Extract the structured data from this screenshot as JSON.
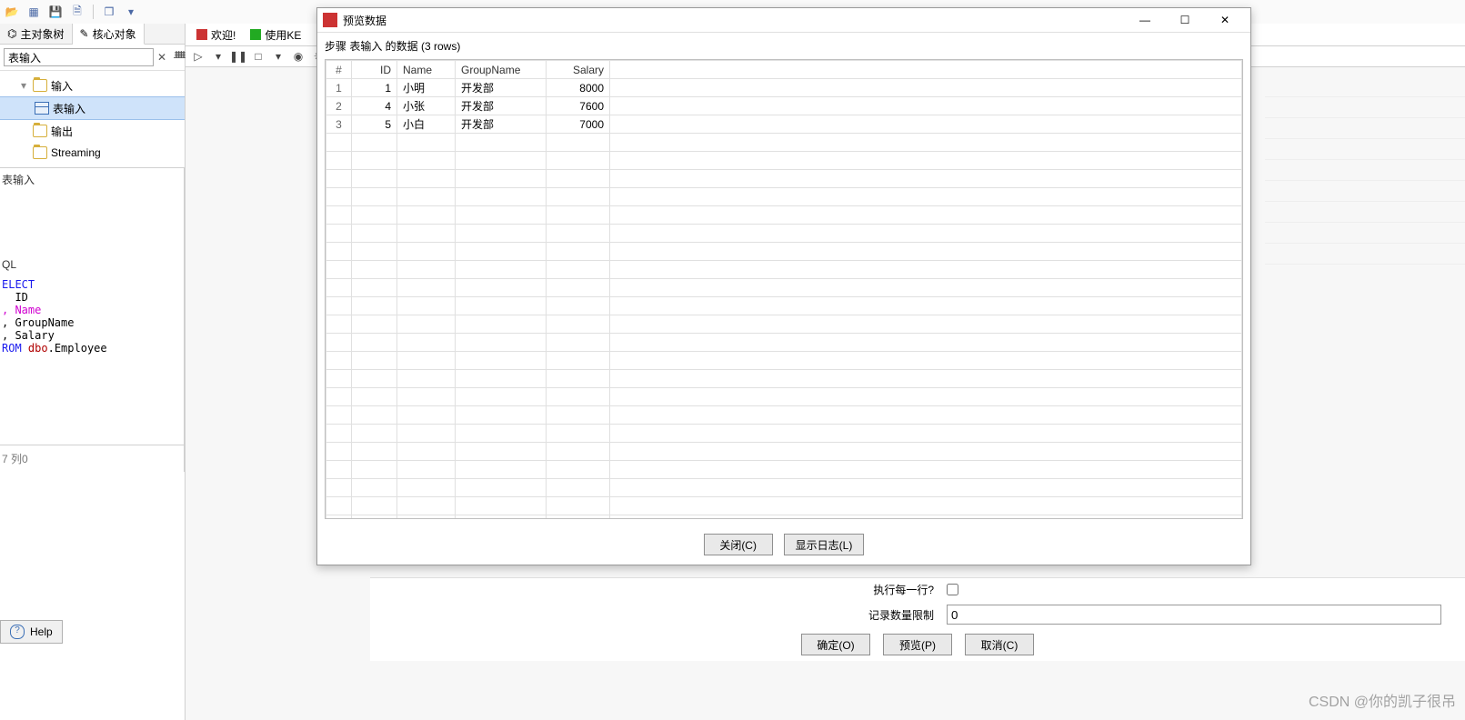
{
  "toolbar": {
    "icons": [
      "open-icon",
      "new-icon",
      "save-icon",
      "save-as-icon",
      "layers-icon",
      "dropdown-icon"
    ]
  },
  "leftPane": {
    "tabs": [
      {
        "label": "主对象树",
        "icon": "tree-icon"
      },
      {
        "label": "核心对象",
        "icon": "pencil-icon"
      }
    ],
    "searchValue": "表输入",
    "tree": [
      {
        "label": "输入",
        "type": "folder",
        "level": 1,
        "expanded": true
      },
      {
        "label": "表输入",
        "type": "step",
        "level": 2,
        "selected": true
      },
      {
        "label": "输出",
        "type": "folder",
        "level": 1
      },
      {
        "label": "Streaming",
        "type": "folder",
        "level": 1
      }
    ],
    "panelLabel": "表输入"
  },
  "sqlFragment": {
    "heading": "QL",
    "lines": [
      {
        "text": "ELECT",
        "cls": "kw"
      },
      {
        "text": "  ID",
        "cls": "plain"
      },
      {
        "text": ", Name",
        "cls": "id"
      },
      {
        "text": ", GroupName",
        "cls": "plain"
      },
      {
        "text": ", Salary",
        "cls": "plain"
      },
      {
        "text": "ROM dbo.Employee",
        "cls": "mix"
      }
    ]
  },
  "statusFragment": "7 列0",
  "helpLabel": "Help",
  "designer": {
    "tabs": [
      {
        "label": "欢迎!",
        "icon": "red"
      },
      {
        "label": "使用KE",
        "icon": "green"
      }
    ],
    "runIcons": [
      "play-icon",
      "pause-icon",
      "stop-icon",
      "restart-icon",
      "preview-icon",
      "debug-icon"
    ]
  },
  "underDialog": {
    "executeEachRowLabel": "执行每一行?",
    "recordLimitLabel": "记录数量限制",
    "recordLimitValue": "0",
    "buttons": {
      "ok": "确定(O)",
      "preview": "预览(P)",
      "cancel": "取消(C)"
    }
  },
  "previewDialog": {
    "title": "预览数据",
    "subtitle": "步骤 表输入 的数据 (3 rows)",
    "columns": [
      "#",
      "ID",
      "Name",
      "GroupName",
      "Salary"
    ],
    "rows": [
      {
        "n": "1",
        "ID": "1",
        "Name": "小明",
        "GroupName": "开发部",
        "Salary": "8000"
      },
      {
        "n": "2",
        "ID": "4",
        "Name": "小张",
        "GroupName": "开发部",
        "Salary": "7600"
      },
      {
        "n": "3",
        "ID": "5",
        "Name": "小白",
        "GroupName": "开发部",
        "Salary": "7000"
      }
    ],
    "emptyRows": 22,
    "buttons": {
      "close": "关闭(C)",
      "showLog": "显示日志(L)"
    }
  },
  "watermark": "CSDN @你的凯子很吊"
}
